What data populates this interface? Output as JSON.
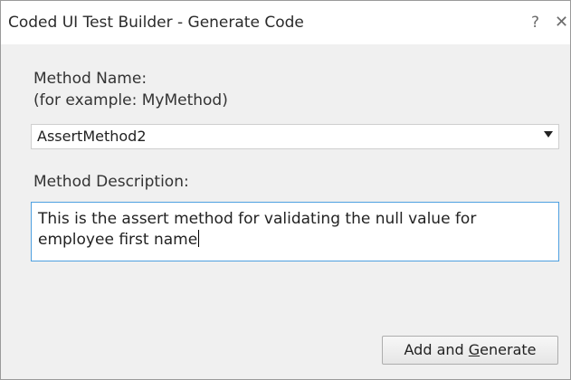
{
  "window": {
    "title": "Coded UI Test Builder - Generate Code",
    "help_glyph": "?",
    "close_glyph": "✕"
  },
  "form": {
    "method_name_label": "Method Name:",
    "method_name_hint": "(for example: MyMethod)",
    "method_name_value": "AssertMethod2",
    "method_description_label": "Method Description:",
    "method_description_value": "This is the assert method for validating the null value for employee first name"
  },
  "actions": {
    "generate_button_prefix": "Add and ",
    "generate_button_accesskey": "G",
    "generate_button_suffix": "enerate"
  }
}
